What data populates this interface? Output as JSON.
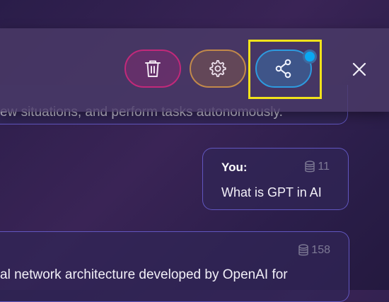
{
  "toolbar": {
    "delete_icon": "trash-icon",
    "settings_icon": "gear-icon",
    "share_icon": "share-icon",
    "close_icon": "close-icon",
    "colors": {
      "delete": "#c2297a",
      "settings": "#c2894a",
      "share": "#2d9be0",
      "highlight": "#f1e21b",
      "badge": "#0aa8f2"
    }
  },
  "messages": {
    "previous_ai_text": "ew situations, and perform tasks autonomously.",
    "user": {
      "name": "You:",
      "tokens": "11",
      "text": "What is GPT in AI"
    },
    "ai": {
      "tokens": "158",
      "text": "al network architecture developed by OpenAI for"
    }
  }
}
